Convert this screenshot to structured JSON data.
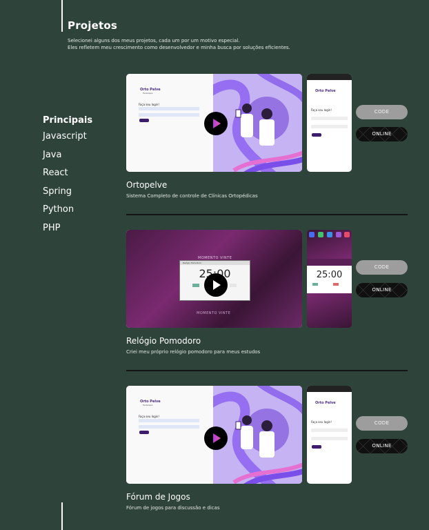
{
  "header": {
    "title": "Projetos",
    "intro_line1": "Selecionei alguns dos meus projetos, cada um por um motivo especial.",
    "intro_line2": "Eles refletem meu crescimento como desenvolvedor e minha busca por soluções eficientes."
  },
  "sidebar": {
    "heading": "Principais",
    "items": [
      {
        "label": "Javascript"
      },
      {
        "label": "Java"
      },
      {
        "label": "React"
      },
      {
        "label": "Spring"
      },
      {
        "label": "Python"
      },
      {
        "label": "PHP"
      }
    ]
  },
  "projects": [
    {
      "name": "Ortopelve",
      "description": "Sistema Completo de controle de Clínicas Ortopédicas",
      "code_label": "CODE",
      "online_label": "ONLINE",
      "preview": {
        "brand": "Orto Pelve",
        "subtitle": "Fisioterapia",
        "login_heading": "Faça seu login!",
        "button": "Entrar",
        "link": "Cadastrar-se"
      }
    },
    {
      "name": "Relógio Pomodoro",
      "description": "Criei meu próprio relógio pomodoro para meus estudos",
      "code_label": "CODE",
      "online_label": "ONLINE",
      "preview": {
        "timer": "25:00",
        "window_title": "Relógio Pomodoro",
        "watermark": "MOMENTO VINTE"
      }
    },
    {
      "name": "Fórum de Jogos",
      "description": "Fórum de jogos para discussão e dicas",
      "code_label": "CODE",
      "online_label": "ONLINE",
      "preview": {
        "brand": "Orto Pelve",
        "subtitle": "Fisioterapia",
        "login_heading": "Faça seu login!",
        "button": "Entrar",
        "link": "Cadastrar-se"
      }
    }
  ],
  "colors": {
    "background": "#2e4339",
    "accent_purple": "#3d1c6b",
    "code_button": "#9d9d9d",
    "online_button": "#101010"
  }
}
